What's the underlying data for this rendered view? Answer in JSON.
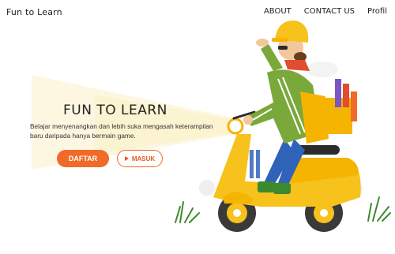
{
  "nav": {
    "brand": "Fun to Learn",
    "links": [
      "ABOUT",
      "CONTACT US",
      "Profil"
    ]
  },
  "hero": {
    "title": "FUN TO LEARN",
    "description": "Belajar menyenangkan dan lebih suka mengasah keterampilan baru daripada hanya bermain game.",
    "primary_button": "DAFTAR",
    "secondary_button": "MASUK"
  },
  "colors": {
    "accent": "#f06a28",
    "scooter_yellow": "#f6c21b",
    "jacket_green": "#7aa83a",
    "pants_blue": "#2f63b8"
  },
  "icons": [
    "play-icon"
  ]
}
